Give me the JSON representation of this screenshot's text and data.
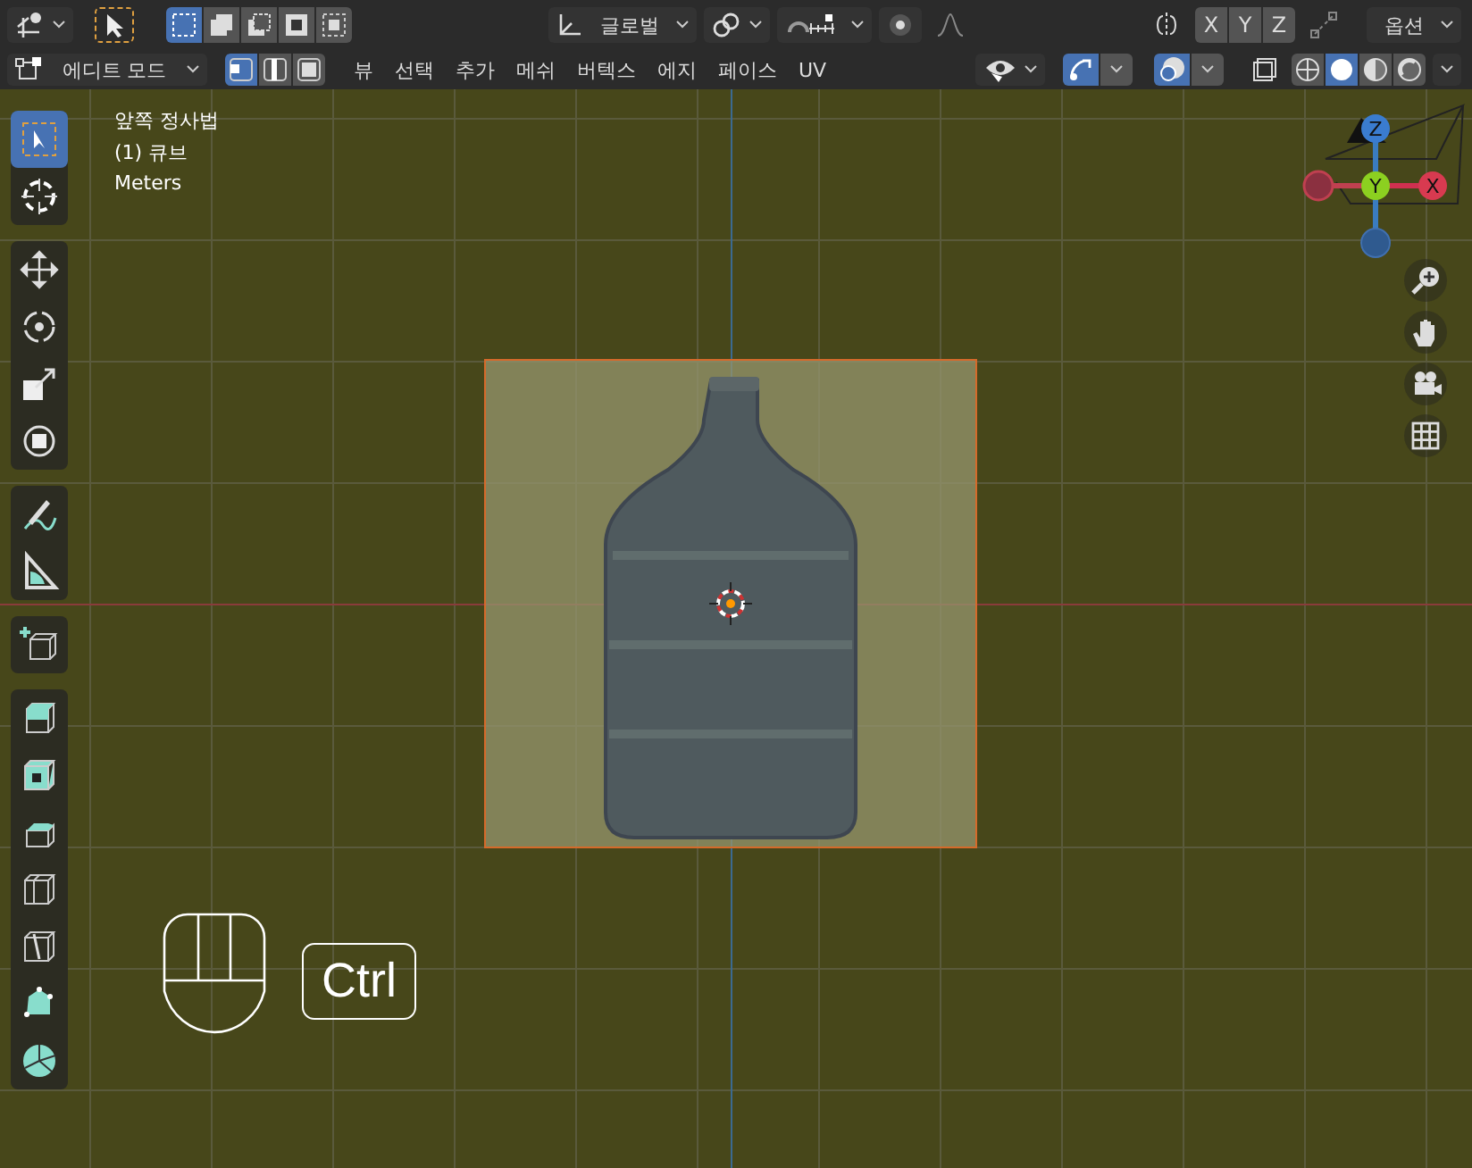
{
  "header": {
    "box_select_modes": [
      {
        "kind": "new",
        "selected": true
      },
      {
        "kind": "extend",
        "selected": false
      },
      {
        "kind": "subtract",
        "selected": false
      },
      {
        "kind": "invert",
        "selected": false
      },
      {
        "kind": "intersect",
        "selected": false
      }
    ],
    "transform_orientation": "글로벌",
    "axis_toggles": [
      "X",
      "Y",
      "Z"
    ],
    "options_menu": "옵션"
  },
  "mode_bar": {
    "mode": "에디트 모드",
    "select_modes": [
      {
        "kind": "vertex",
        "selected": true
      },
      {
        "kind": "edge",
        "selected": false
      },
      {
        "kind": "face",
        "selected": false
      }
    ],
    "menus": [
      "뷰",
      "선택",
      "추가",
      "메쉬",
      "버텍스",
      "에지",
      "페이스",
      "UV"
    ],
    "shading_modes": [
      {
        "kind": "wireframe",
        "selected": false
      },
      {
        "kind": "solid",
        "selected": true
      },
      {
        "kind": "material",
        "selected": false
      },
      {
        "kind": "rendered",
        "selected": false
      }
    ]
  },
  "viewport": {
    "info": [
      "앞쪽 정사법",
      "(1) 큐브",
      "Meters"
    ],
    "gizmo_axes": [
      "Z",
      "Y",
      "X"
    ],
    "key_hint": "Ctrl"
  },
  "toolbar": [
    {
      "tools": [
        {
          "kind": "select",
          "selected": true
        },
        {
          "kind": "cursor",
          "selected": false
        }
      ]
    },
    {
      "tools": [
        {
          "kind": "move",
          "selected": false
        },
        {
          "kind": "rotate",
          "selected": false
        },
        {
          "kind": "scale",
          "selected": false
        },
        {
          "kind": "transform",
          "selected": false
        }
      ]
    },
    {
      "tools": [
        {
          "kind": "annotate",
          "selected": false
        },
        {
          "kind": "measure",
          "selected": false
        }
      ]
    },
    {
      "tools": [
        {
          "kind": "add-cube",
          "selected": false
        }
      ]
    },
    {
      "tools": [
        {
          "kind": "extrude",
          "selected": false
        },
        {
          "kind": "inset",
          "selected": false
        },
        {
          "kind": "bevel",
          "selected": false
        },
        {
          "kind": "loop-cut",
          "selected": false
        },
        {
          "kind": "knife",
          "selected": false
        },
        {
          "kind": "poly-build",
          "selected": false
        },
        {
          "kind": "spin",
          "selected": false
        }
      ]
    }
  ]
}
